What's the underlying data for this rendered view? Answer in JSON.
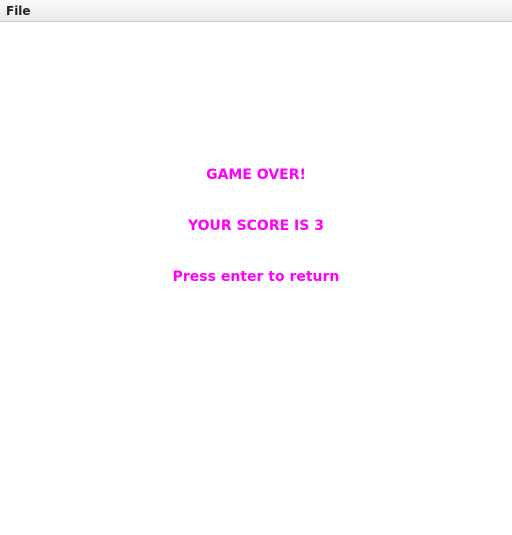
{
  "menubar": {
    "items": [
      {
        "label": "File"
      }
    ]
  },
  "game": {
    "title": "GAME OVER!",
    "score_text": "YOUR SCORE IS 3",
    "prompt": "Press enter to return",
    "text_color": "#ff00ff"
  }
}
